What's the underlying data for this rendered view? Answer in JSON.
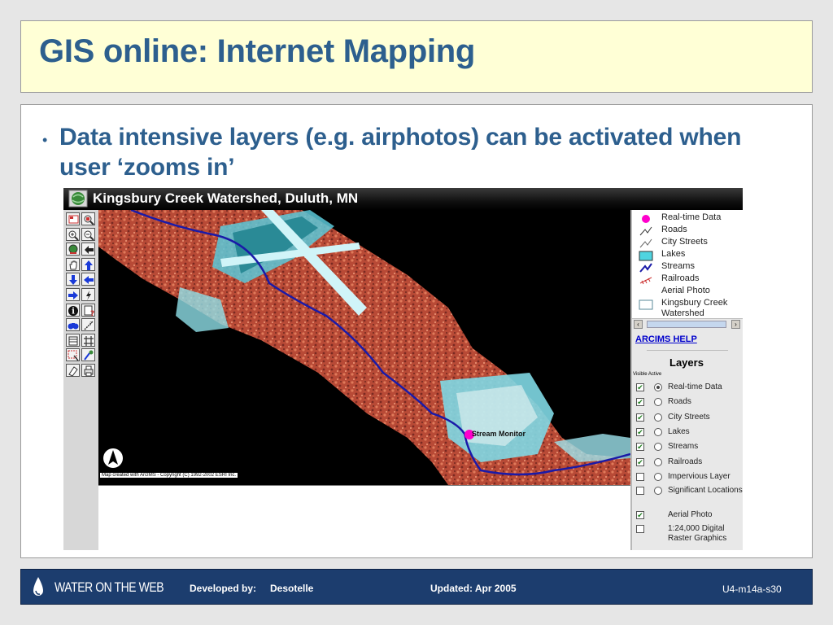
{
  "slide": {
    "title": "GIS online: Internet Mapping",
    "bullet_marker": "•",
    "bullet_text": "Data intensive layers (e.g. airphotos) can be activated when user ‘zooms in’"
  },
  "arcims": {
    "window_title": "Kingsbury Creek Watershed, Duluth, MN",
    "copyright": "Map created with ArcIMS - Copyright (C) 1992-2002 ESRI Inc.",
    "map_label": "Stream Monitor",
    "legend": [
      {
        "label": "Real-time Data",
        "icon": "magenta-dot-icon"
      },
      {
        "label": "Roads",
        "icon": "roads-line-icon"
      },
      {
        "label": "City Streets",
        "icon": "streets-line-icon"
      },
      {
        "label": "Lakes",
        "icon": "lakes-swatch-icon"
      },
      {
        "label": "Streams",
        "icon": "streams-line-icon"
      },
      {
        "label": "Railroads",
        "icon": "railroads-line-icon"
      },
      {
        "label": "Aerial Photo",
        "icon": ""
      },
      {
        "label": "Kingsbury Creek Watershed",
        "icon": "watershed-swatch-icon"
      }
    ],
    "help_link": "ARCIMS HELP",
    "layers_title": "Layers",
    "visible_active_label": "Visible Active",
    "layers": [
      {
        "label": "Real-time Data",
        "visible": true,
        "active": true
      },
      {
        "label": "Roads",
        "visible": true,
        "active": false
      },
      {
        "label": "City Streets",
        "visible": true,
        "active": false
      },
      {
        "label": "Lakes",
        "visible": true,
        "active": false
      },
      {
        "label": "Streams",
        "visible": true,
        "active": false
      },
      {
        "label": "Railroads",
        "visible": true,
        "active": false
      },
      {
        "label": "Impervious Layer",
        "visible": false,
        "active": false
      },
      {
        "label": "Significant Locations",
        "visible": false,
        "active": false
      },
      {
        "label": "Aerial Photo",
        "visible": true,
        "active": null
      },
      {
        "label": "1:24,000 Digital Raster Graphics",
        "visible": false,
        "active": null
      }
    ],
    "toolbar_icons": [
      "toggle-legend-icon",
      "overview-map-icon",
      "zoom-in-icon",
      "zoom-out-icon",
      "zoom-full-icon",
      "zoom-back-icon",
      "pan-hand-icon",
      "pan-north-icon",
      "pan-south-icon",
      "pan-west-icon",
      "pan-east-icon",
      "hyperlink-icon",
      "identify-icon",
      "query-icon",
      "find-icon",
      "measure-icon",
      "select-icon",
      "buffer-icon",
      "select-rectangle-icon",
      "select-line-icon",
      "clear-selection-icon",
      "print-icon"
    ],
    "colors": {
      "titlebar": "#000000",
      "map_bg": "#000000",
      "vegetation": "#c0503a",
      "water": "#4fd4e0",
      "stream": "#1a1aa8",
      "realtime_point": "#ff00cc",
      "link": "#0000cc"
    }
  },
  "footer": {
    "logo_text": "WATER ON THE WEB",
    "developed_label": "Developed by:",
    "developer": "Desotelle",
    "updated": "Updated: Apr 2005",
    "slide_id": "U4-m14a-s30"
  },
  "theme": {
    "title_color": "#2d5f8e",
    "title_bg": "#ffffd6",
    "footer_bg": "#1c3d6e"
  }
}
